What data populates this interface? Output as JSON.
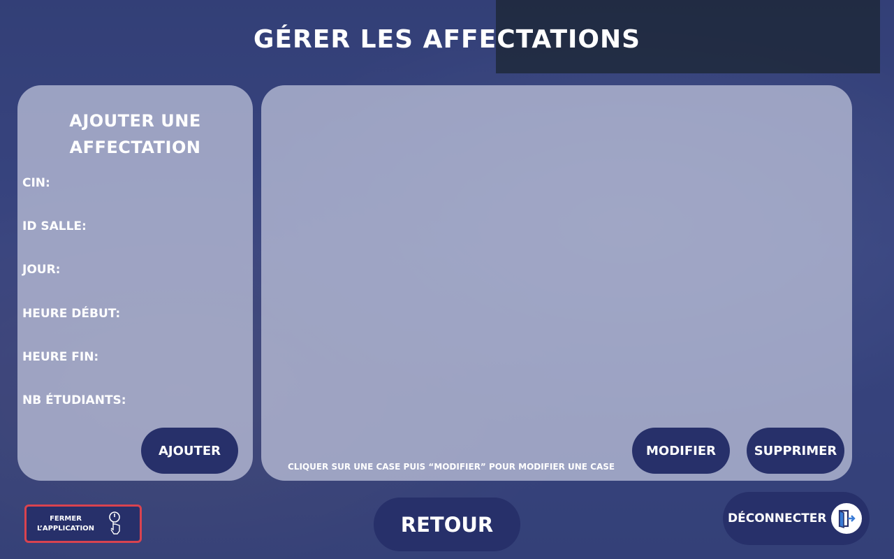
{
  "page": {
    "title": "GÉRER LES AFFECTATIONS"
  },
  "form": {
    "title": "AJOUTER UNE\nAFFECTATION",
    "fields": [
      {
        "label": "CIN:"
      },
      {
        "label": "ID SALLE:"
      },
      {
        "label": "JOUR:"
      },
      {
        "label": "HEURE DÉBUT:"
      },
      {
        "label": "HEURE FIN:"
      },
      {
        "label": "NB ÉTUDIANTS:"
      }
    ],
    "submit_label": "AJOUTER"
  },
  "table_panel": {
    "hint": "CLIQUER SUR UNE CASE PUIS “MODIFIER” POUR MODIFIER UNE CASE",
    "modify_label": "MODIFIER",
    "delete_label": "SUPPRIMER"
  },
  "footer": {
    "close_app_label": "FERMER\nL’APPLICATION",
    "close_app_icon": "power-touch-icon",
    "back_label": "RETOUR",
    "logout_label": "DÉCONNECTER",
    "logout_icon": "exit-door-icon"
  },
  "colors": {
    "button_bg": "#27306a",
    "panel_bg": "rgba(195,200,222,0.72)",
    "close_border": "#d9434f",
    "text": "#ffffff"
  }
}
